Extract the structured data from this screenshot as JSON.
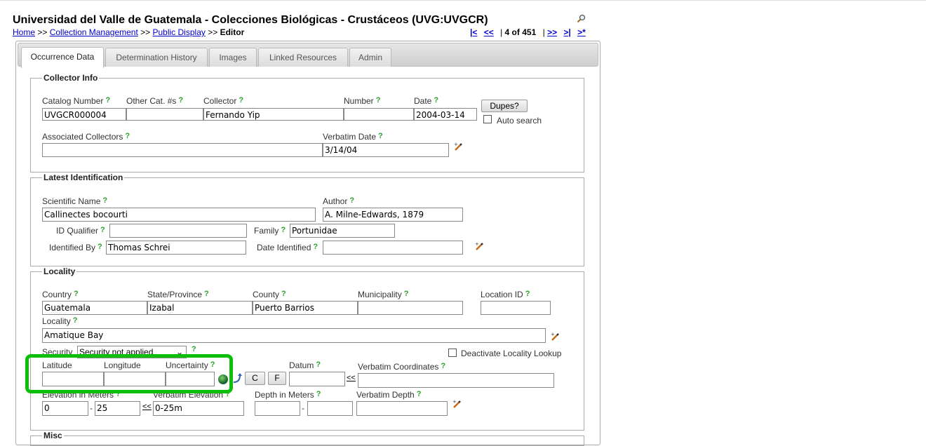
{
  "header": {
    "title": "Universidad del Valle de Guatemala - Colecciones Biológicas - Crustáceos (UVG:UVGCR)",
    "breadcrumb": {
      "home": "Home",
      "sep": ">>",
      "collection_management": "Collection Management",
      "public_display": "Public Display",
      "current": "Editor"
    },
    "pager": {
      "first": "|<",
      "prev": "<<",
      "position": "4 of 451",
      "next": ">>",
      "last": ">|",
      "new": ">*"
    }
  },
  "tabs": [
    {
      "label": "Occurrence Data",
      "active": true
    },
    {
      "label": "Determination History",
      "active": false
    },
    {
      "label": "Images",
      "active": false
    },
    {
      "label": "Linked Resources",
      "active": false
    },
    {
      "label": "Admin",
      "active": false
    }
  ],
  "help_glyph": "?",
  "collector_info": {
    "legend": "Collector Info",
    "catalog_number": {
      "label": "Catalog Number",
      "value": "UVGCR000004"
    },
    "other_cat": {
      "label": "Other Cat. #s",
      "value": ""
    },
    "collector": {
      "label": "Collector",
      "value": "Fernando Yip"
    },
    "number": {
      "label": "Number",
      "value": ""
    },
    "date": {
      "label": "Date",
      "value": "2004-03-14"
    },
    "dupes_button": "Dupes?",
    "auto_search": "Auto search",
    "associated_collectors": {
      "label": "Associated Collectors",
      "value": ""
    },
    "verbatim_date": {
      "label": "Verbatim Date",
      "value": "3/14/04"
    }
  },
  "latest_identification": {
    "legend": "Latest Identification",
    "scientific_name": {
      "label": "Scientific Name",
      "value": "Callinectes bocourti"
    },
    "author": {
      "label": "Author",
      "value": "A. Milne-Edwards, 1879"
    },
    "id_qualifier": {
      "label": "ID Qualifier",
      "value": ""
    },
    "family": {
      "label": "Family",
      "value": "Portunidae"
    },
    "identified_by": {
      "label": "Identified By",
      "value": "Thomas Schrei"
    },
    "date_identified": {
      "label": "Date Identified",
      "value": ""
    }
  },
  "locality_section": {
    "legend": "Locality",
    "country": {
      "label": "Country",
      "value": "Guatemala"
    },
    "state": {
      "label": "State/Province",
      "value": "Izabal"
    },
    "county": {
      "label": "County",
      "value": "Puerto Barrios"
    },
    "municipality": {
      "label": "Municipality",
      "value": ""
    },
    "location_id": {
      "label": "Location ID",
      "value": ""
    },
    "locality": {
      "label": "Locality",
      "value": "Amatique Bay"
    },
    "security": {
      "label": "Security",
      "value": "Security not applied"
    },
    "deactivate_lookup": "Deactivate Locality Lookup",
    "latitude": {
      "label": "Latitude",
      "value": ""
    },
    "longitude": {
      "label": "Longitude",
      "value": ""
    },
    "uncertainty": {
      "label": "Uncertainty",
      "value": ""
    },
    "c_button": "C",
    "f_button": "F",
    "datum": {
      "label": "Datum",
      "value": ""
    },
    "copy_arrow": "<<",
    "verbatim_coordinates": {
      "label": "Verbatim Coordinates",
      "value": ""
    },
    "elevation": {
      "label": "Elevation in Meters",
      "min": "0",
      "dash": "-",
      "max": "25"
    },
    "verbatim_elevation": {
      "label": "Verbatim Elevation",
      "value": "0-25m"
    },
    "depth": {
      "label": "Depth in Meters",
      "min": "",
      "dash": "-",
      "max": ""
    },
    "verbatim_depth": {
      "label": "Verbatim Depth",
      "value": ""
    }
  },
  "misc": {
    "legend": "Misc"
  },
  "colors": {
    "highlight": "#0bbf0b",
    "link": "#0000cc",
    "help": "#2aa02a"
  }
}
